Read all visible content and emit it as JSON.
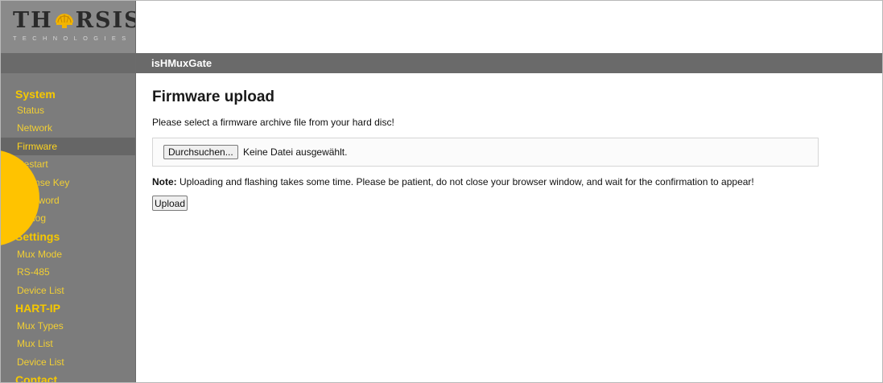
{
  "brand": {
    "logo_left": "TH",
    "logo_right": "RSIS",
    "logo_sub": "TECHNOLOGIES",
    "emblem_icon": "helmet-icon"
  },
  "header": {
    "device_name": "isHMuxGate"
  },
  "sidebar": {
    "sections": [
      {
        "label": "System",
        "items": [
          "Status",
          "Network",
          "Firmware",
          "Restart",
          "License Key",
          "Password",
          "Syslog"
        ]
      },
      {
        "label": "Settings",
        "items": [
          "Mux Mode",
          "RS-485",
          "Device List"
        ]
      },
      {
        "label": "HART-IP",
        "items": [
          "Mux Types",
          "Mux List",
          "Device List"
        ]
      },
      {
        "label": "Contact",
        "items": []
      }
    ],
    "active_item": "Firmware"
  },
  "main": {
    "title": "Firmware upload",
    "instruction": "Please select a firmware archive file from your hard disc!",
    "file_input": {
      "button_label": "Durchsuchen...",
      "status": "Keine Datei ausgewählt."
    },
    "note_label": "Note:",
    "note_text": "Uploading and flashing takes some time. Please be patient, do not close your browser window, and wait for the confirmation to appear!",
    "upload_button": "Upload"
  },
  "colors": {
    "sidebar_bg": "#7c7c7c",
    "header_bar": "#6a6a6a",
    "nav_accent": "#f6c800",
    "marker": "#ffc300"
  }
}
